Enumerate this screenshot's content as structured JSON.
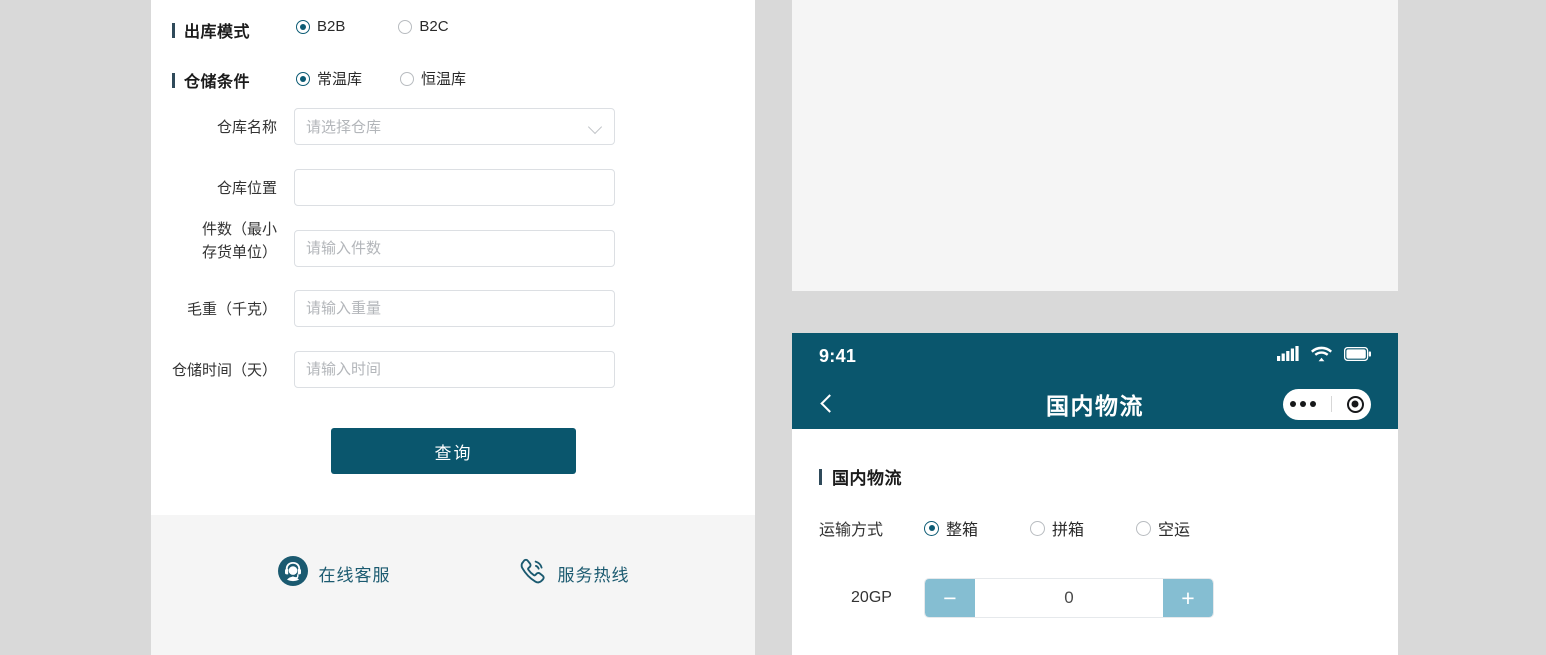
{
  "colors": {
    "teal": "#0a566d",
    "accent_bar": "#2f4a5a",
    "stepper_btn": "#85bed2",
    "page_bg": "#d9d9d9",
    "panel_bg": "#f5f5f5"
  },
  "form": {
    "outbound_mode": {
      "label": "出库模式",
      "options": [
        {
          "label": "B2B",
          "selected": true
        },
        {
          "label": "B2C",
          "selected": false
        }
      ]
    },
    "storage_condition": {
      "label": "仓储条件",
      "options": [
        {
          "label": "常温库",
          "selected": true
        },
        {
          "label": "恒温库",
          "selected": false
        }
      ]
    },
    "warehouse_name": {
      "label": "仓库名称",
      "value": "",
      "placeholder": "请选择仓库"
    },
    "warehouse_location": {
      "label": "仓库位置",
      "value": "",
      "placeholder": ""
    },
    "piece_count": {
      "label_line1": "件数（最小",
      "label_line2": "存货单位）",
      "value": "",
      "placeholder": "请输入件数"
    },
    "gross_weight": {
      "label": "毛重（千克）",
      "value": "",
      "placeholder": "请输入重量"
    },
    "storage_days": {
      "label": "仓储时间（天）",
      "value": "",
      "placeholder": "请输入时间"
    },
    "submit_label": "查询"
  },
  "footer": {
    "links": [
      {
        "icon": "headset-support-icon",
        "label": "在线客服"
      },
      {
        "icon": "phone-hotline-icon",
        "label": "服务热线"
      }
    ]
  },
  "phone": {
    "status": {
      "time": "9:41",
      "icons": [
        "signal-bars-icon",
        "wifi-icon",
        "battery-icon"
      ]
    },
    "nav": {
      "back_icon": "back-chevron-icon",
      "title": "国内物流",
      "capsule": {
        "menu_icon": "more-dots-icon",
        "target_icon": "target-circle-icon"
      }
    },
    "section_title": "国内物流",
    "transport": {
      "label": "运输方式",
      "options": [
        {
          "label": "整箱",
          "selected": true
        },
        {
          "label": "拼箱",
          "selected": false
        },
        {
          "label": "空运",
          "selected": false
        }
      ]
    },
    "container_stepper": {
      "label": "20GP",
      "minus_label": "−",
      "plus_label": "+",
      "value": "0"
    }
  }
}
